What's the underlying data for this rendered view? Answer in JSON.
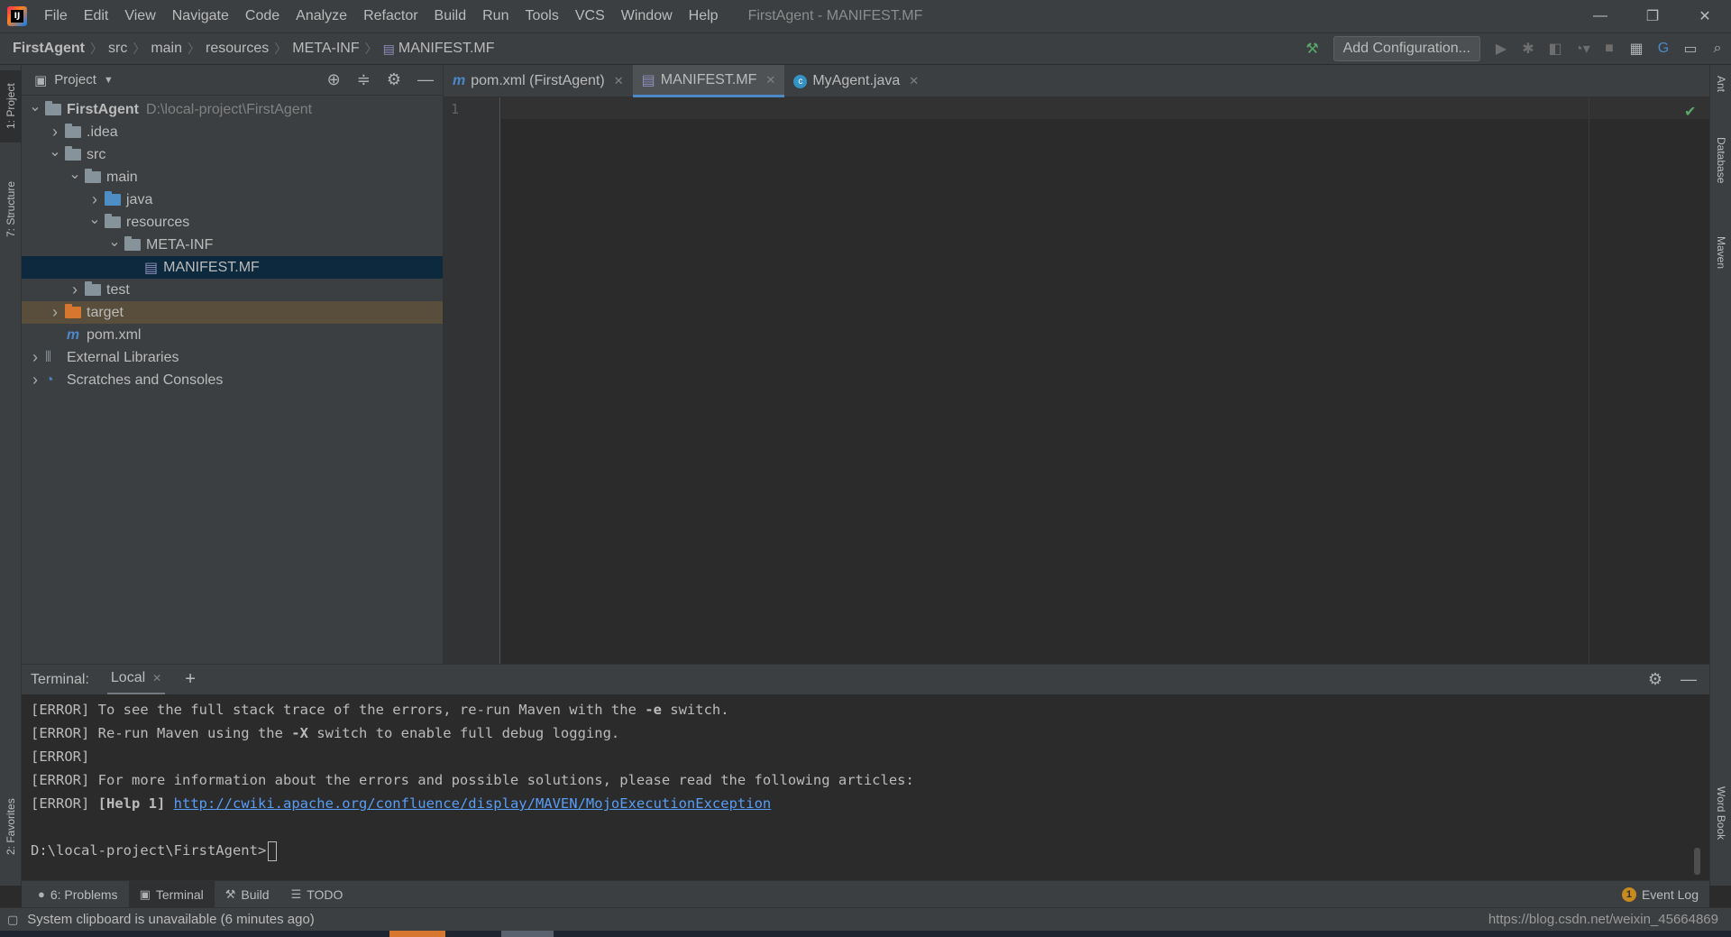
{
  "window": {
    "title": "FirstAgent - MANIFEST.MF",
    "menu": [
      "File",
      "Edit",
      "View",
      "Navigate",
      "Code",
      "Analyze",
      "Refactor",
      "Build",
      "Run",
      "Tools",
      "VCS",
      "Window",
      "Help"
    ],
    "controls": {
      "minimize": "—",
      "restore": "❐",
      "close": "✕"
    }
  },
  "breadcrumb": [
    "FirstAgent",
    "src",
    "main",
    "resources",
    "META-INF",
    "MANIFEST.MF"
  ],
  "toolbar": {
    "add_configuration": "Add Configuration..."
  },
  "left_stripe": {
    "project_tab": "1: Project",
    "structure_tab": "7: Structure",
    "favorites_tab": "2: Favorites"
  },
  "right_stripe": {
    "ant": "Ant",
    "database": "Database",
    "maven": "Maven",
    "word_book": "Word Book"
  },
  "project_panel": {
    "title": "Project",
    "tree": [
      {
        "label": "FirstAgent",
        "hint": "D:\\local-project\\FirstAgent",
        "depth": 0,
        "expanded": true,
        "kind": "module"
      },
      {
        "label": ".idea",
        "depth": 1,
        "expanded": false,
        "kind": "folder"
      },
      {
        "label": "src",
        "depth": 1,
        "expanded": true,
        "kind": "folder"
      },
      {
        "label": "main",
        "depth": 2,
        "expanded": true,
        "kind": "folder"
      },
      {
        "label": "java",
        "depth": 3,
        "expanded": false,
        "kind": "source"
      },
      {
        "label": "resources",
        "depth": 3,
        "expanded": true,
        "kind": "resources"
      },
      {
        "label": "META-INF",
        "depth": 4,
        "expanded": true,
        "kind": "folder"
      },
      {
        "label": "MANIFEST.MF",
        "depth": 5,
        "kind": "manifest",
        "selected": true
      },
      {
        "label": "test",
        "depth": 2,
        "expanded": false,
        "kind": "folder"
      },
      {
        "label": "target",
        "depth": 1,
        "expanded": false,
        "kind": "excluded"
      },
      {
        "label": "pom.xml",
        "depth": 1,
        "kind": "maven"
      },
      {
        "label": "External Libraries",
        "depth": 0,
        "expanded": false,
        "kind": "libraries"
      },
      {
        "label": "Scratches and Consoles",
        "depth": 0,
        "expanded": false,
        "kind": "scratches"
      }
    ]
  },
  "editor": {
    "tabs": [
      {
        "label": "pom.xml (FirstAgent)",
        "icon": "m",
        "active": false
      },
      {
        "label": "MANIFEST.MF",
        "icon": "MF",
        "active": true
      },
      {
        "label": "MyAgent.java",
        "icon": "C",
        "active": false
      }
    ],
    "line_numbers": [
      "1"
    ]
  },
  "terminal": {
    "label": "Terminal:",
    "tab": "Local",
    "add": "+",
    "lines": [
      {
        "prefix": "[ERROR]",
        "text": " To see the full stack trace of the errors, re-run Maven with the ",
        "bold": "-e",
        "suffix": " switch."
      },
      {
        "prefix": "[ERROR]",
        "text": " Re-run Maven using the ",
        "bold": "-X",
        "suffix": " switch to enable full debug logging."
      },
      {
        "prefix": "[ERROR]",
        "text": "",
        "bold": "",
        "suffix": ""
      },
      {
        "prefix": "[ERROR]",
        "text": " For more information about the errors and possible solutions, please read the following articles:",
        "bold": "",
        "suffix": ""
      },
      {
        "prefix": "[ERROR]",
        "text": " ",
        "bold": "[Help 1]",
        "suffix": " ",
        "link": "http://cwiki.apache.org/confluence/display/MAVEN/MojoExecutionException"
      }
    ],
    "prompt": "D:\\local-project\\FirstAgent>"
  },
  "tool_windows": [
    {
      "label": "6: Problems",
      "icon": "problems-icon"
    },
    {
      "label": "Terminal",
      "icon": "terminal-icon",
      "active": true
    },
    {
      "label": "Build",
      "icon": "hammer-icon"
    },
    {
      "label": "TODO",
      "icon": "list-icon"
    }
  ],
  "event_log": {
    "label": "Event Log",
    "count": "1"
  },
  "status": {
    "message": "System clipboard is unavailable (6 minutes ago)",
    "right": "https://blog.csdn.net/weixin_45664869"
  }
}
